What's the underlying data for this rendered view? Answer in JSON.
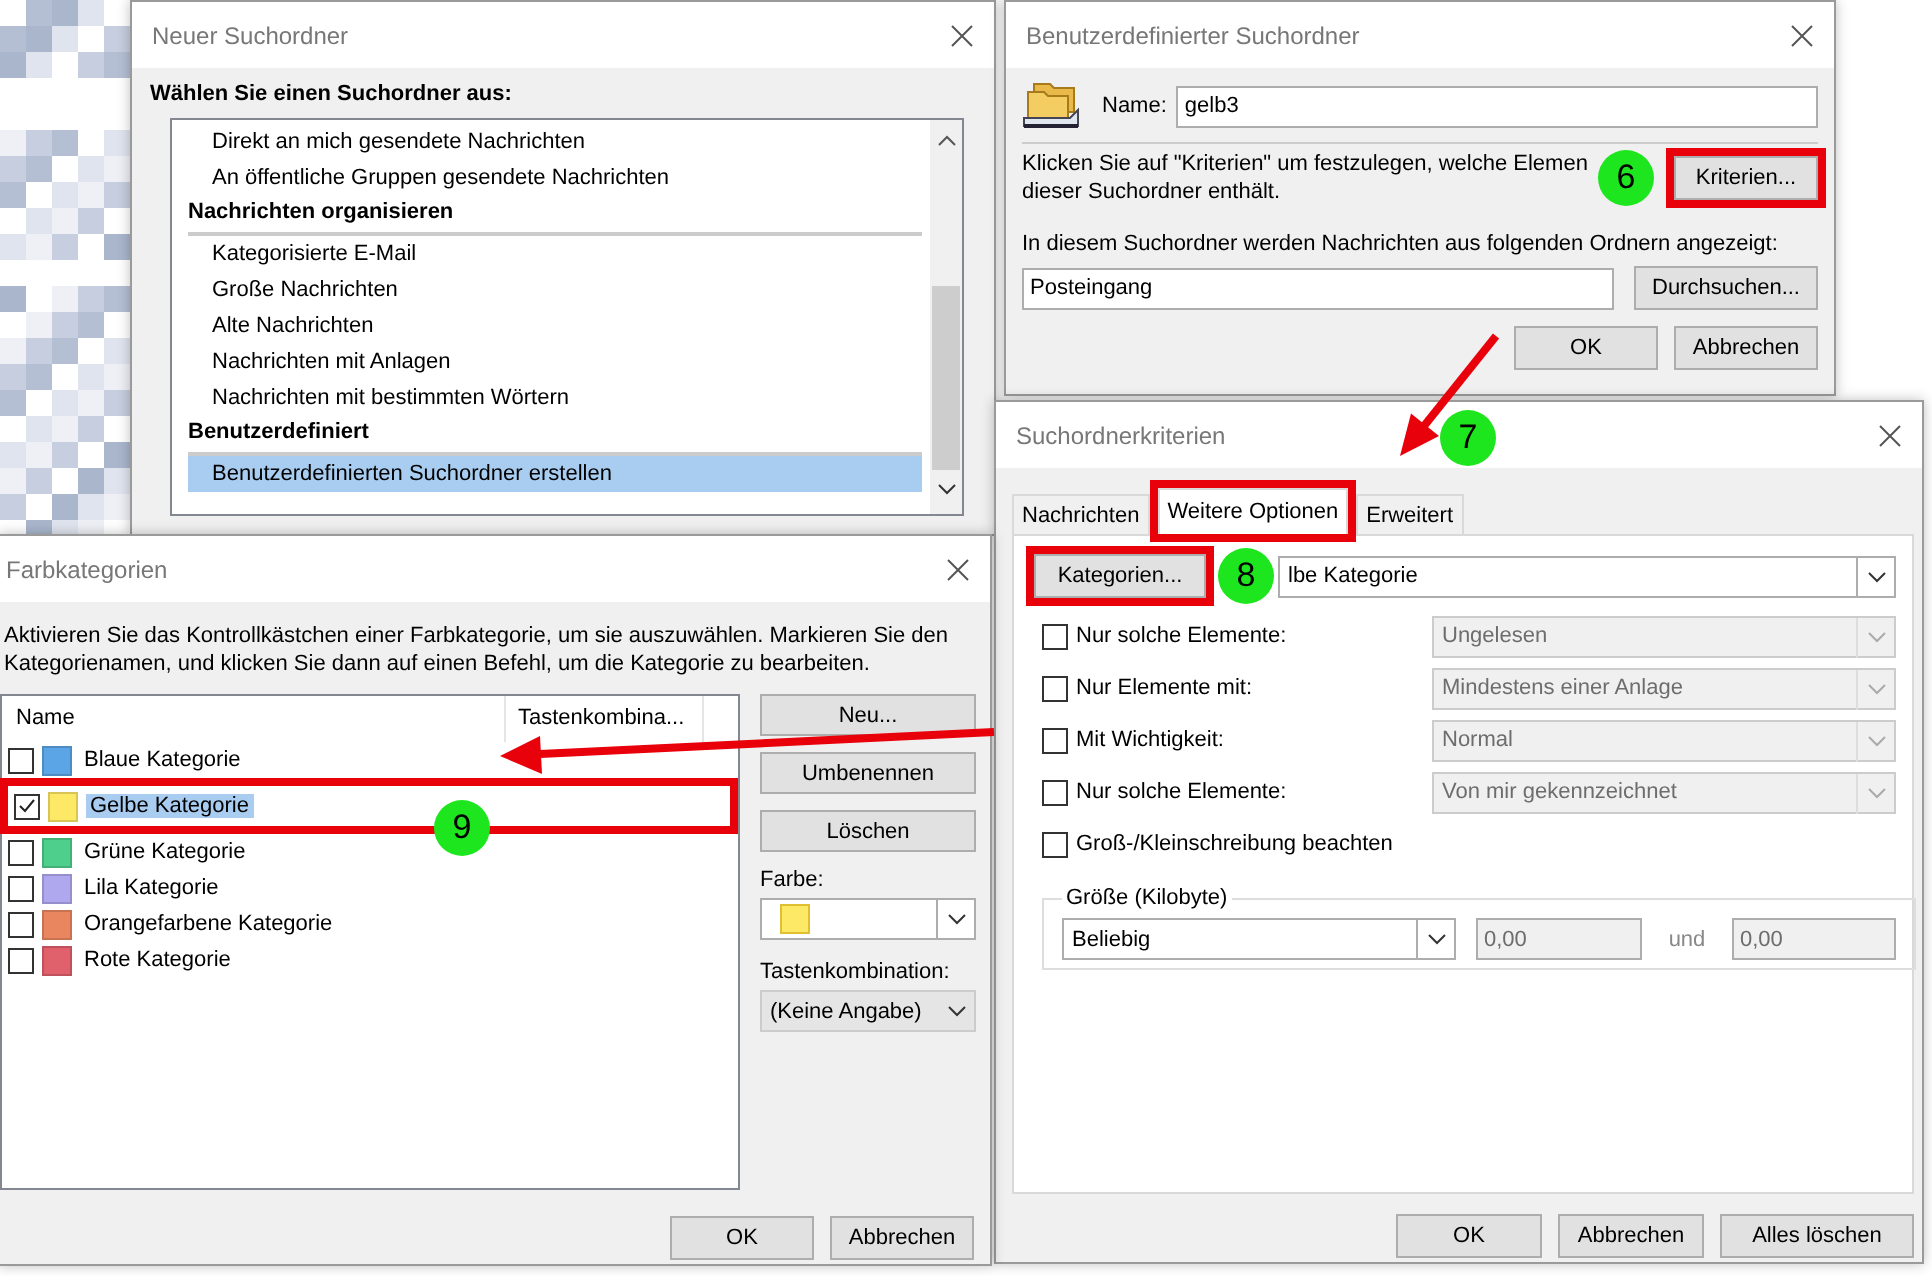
{
  "neuer_suchordner": {
    "title": "Neuer Suchordner",
    "heading": "Wählen Sie einen Suchordner aus:",
    "list": [
      {
        "kind": "item",
        "label": "Direkt an mich gesendete Nachrichten",
        "selected": false
      },
      {
        "kind": "item",
        "label": "An öffentliche Gruppen gesendete Nachrichten",
        "selected": false
      },
      {
        "kind": "group",
        "label": "Nachrichten organisieren"
      },
      {
        "kind": "item",
        "label": "Kategorisierte E-Mail",
        "selected": false
      },
      {
        "kind": "item",
        "label": "Große Nachrichten",
        "selected": false
      },
      {
        "kind": "item",
        "label": "Alte Nachrichten",
        "selected": false
      },
      {
        "kind": "item",
        "label": "Nachrichten mit Anlagen",
        "selected": false
      },
      {
        "kind": "item",
        "label": "Nachrichten mit bestimmten Wörtern",
        "selected": false
      },
      {
        "kind": "group",
        "label": "Benutzerdefiniert"
      },
      {
        "kind": "item",
        "label": "Benutzerdefinierten Suchordner erstellen",
        "selected": true
      }
    ]
  },
  "benutzerdefinierter_suchordner": {
    "title": "Benutzerdefinierter Suchordner",
    "name_label": "Name:",
    "name_value": "gelb3",
    "hint_lines": [
      "Klicken Sie auf \"Kriterien\" um festzulegen, welche Elemen",
      "dieser Suchordner enthält."
    ],
    "criteria_button": "Kriterien...",
    "folders_label": "In diesem Suchordner werden Nachrichten aus folgenden Ordnern angezeigt:",
    "folders_value": "Posteingang",
    "browse_button": "Durchsuchen...",
    "buttons": [
      "OK",
      "Abbrechen"
    ]
  },
  "suchordnerkriterien": {
    "title": "Suchordnerkriterien",
    "tabs": [
      {
        "label": "Nachrichten",
        "selected": false,
        "highlight_frame": false
      },
      {
        "label": "Weitere Optionen",
        "selected": true,
        "highlight_frame": true
      },
      {
        "label": "Erweitert",
        "selected": false,
        "highlight_frame": false
      }
    ],
    "categories_button": "Kategorien...",
    "categories_value": "lbe Kategorie",
    "options": [
      {
        "kind": "dropdown",
        "label": "Nur solche Elemente:",
        "checked": false,
        "value": "Ungelesen",
        "disabled": true
      },
      {
        "kind": "dropdown",
        "label": "Nur Elemente mit:",
        "checked": false,
        "value": "Mindestens einer Anlage",
        "disabled": true
      },
      {
        "kind": "dropdown",
        "label": "Mit Wichtigkeit:",
        "checked": false,
        "value": "Normal",
        "disabled": true
      },
      {
        "kind": "dropdown",
        "label": "Nur solche Elemente:",
        "checked": false,
        "value": "Von mir gekennzeichnet",
        "disabled": true
      },
      {
        "kind": "checkbox",
        "label": "Groß-/Kleinschreibung beachten",
        "checked": false
      }
    ],
    "size": {
      "legend": "Größe (Kilobyte)",
      "value": "Beliebig",
      "from": "0,00",
      "and_label": "und",
      "to": "0,00"
    },
    "buttons": [
      "OK",
      "Abbrechen",
      "Alles löschen"
    ]
  },
  "farbkategorien": {
    "title": "Farbkategorien",
    "description": "Aktivieren Sie das Kontrollkästchen einer Farbkategorie, um sie auszuwählen. Markieren Sie den Kategorienamen, und klicken Sie dann auf einen Befehl, um die Kategorie zu bearbeiten.",
    "columns": [
      "Name",
      "Tastenkombina..."
    ],
    "categories": [
      {
        "name": "Blaue Kategorie",
        "color": "#5ba4e6",
        "checked": false,
        "selected": false,
        "highlight_frame": false
      },
      {
        "name": "Gelbe Kategorie",
        "color": "#fde965",
        "checked": true,
        "selected": true,
        "highlight_frame": true
      },
      {
        "name": "Grüne Kategorie",
        "color": "#4fcf8c",
        "checked": false,
        "selected": false,
        "highlight_frame": false
      },
      {
        "name": "Lila Kategorie",
        "color": "#b0a8ef",
        "checked": false,
        "selected": false,
        "highlight_frame": false
      },
      {
        "name": "Orangefarbene Kategorie",
        "color": "#ea865f",
        "checked": false,
        "selected": false,
        "highlight_frame": false
      },
      {
        "name": "Rote Kategorie",
        "color": "#e0606c",
        "checked": false,
        "selected": false,
        "highlight_frame": false
      }
    ],
    "side_buttons": [
      "Neu...",
      "Umbenennen",
      "Löschen"
    ],
    "color_label": "Farbe:",
    "shortcut_label": "Tastenkombination:",
    "shortcut_value": "(Keine Angabe)",
    "buttons": [
      "OK",
      "Abbrechen"
    ]
  },
  "steps": [
    {
      "label": "6"
    },
    {
      "label": "7"
    },
    {
      "label": "8"
    },
    {
      "label": "9"
    }
  ]
}
